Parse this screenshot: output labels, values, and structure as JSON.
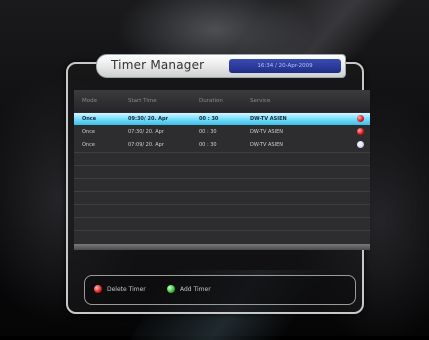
{
  "title": "Timer Manager",
  "clock": "16:34 / 20-Apr-2009",
  "columns": {
    "mode": "Mode",
    "start_time": "Start Time",
    "duration": "Duration",
    "service": "Service"
  },
  "rows": [
    {
      "mode": "Once",
      "start_time": "09:30/ 20. Apr",
      "duration": "00 : 30",
      "service": "DW-TV ASIEN",
      "icon": "red-record-icon",
      "selected": true
    },
    {
      "mode": "Once",
      "start_time": "07:30/ 20. Apr",
      "duration": "00 : 30",
      "service": "DW-TV ASIEN",
      "icon": "red-record-icon",
      "selected": false
    },
    {
      "mode": "Once",
      "start_time": "07:09/ 20. Apr",
      "duration": "00 : 30",
      "service": "DW-TV ASIEN",
      "icon": "white-record-icon",
      "selected": false
    }
  ],
  "help": {
    "delete_label": "Delete Timer",
    "add_label": "Add Timer"
  },
  "colors": {
    "selection": "#3bbfe6",
    "red_button": "#e01818",
    "green_button": "#2fbf2f",
    "clock_bg": "#1f2c86"
  }
}
